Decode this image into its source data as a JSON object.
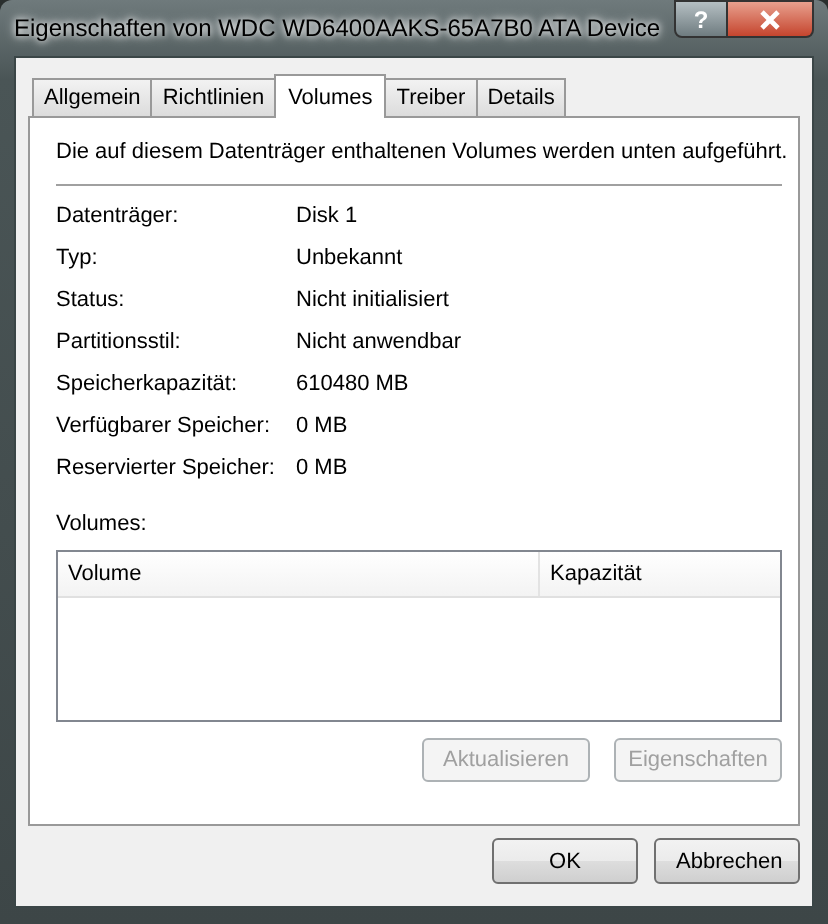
{
  "window": {
    "title": "Eigenschaften von WDC WD6400AAKS-65A7B0 ATA Device",
    "help": "?"
  },
  "tabs": [
    {
      "label": "Allgemein",
      "selected": false
    },
    {
      "label": "Richtlinien",
      "selected": false
    },
    {
      "label": "Volumes",
      "selected": true
    },
    {
      "label": "Treiber",
      "selected": false
    },
    {
      "label": "Details",
      "selected": false
    }
  ],
  "intro": "Die auf diesem Datenträger enthaltenen Volumes werden unten aufgeführt.",
  "properties": [
    {
      "label": "Datenträger:",
      "value": "Disk 1"
    },
    {
      "label": "Typ:",
      "value": "Unbekannt"
    },
    {
      "label": "Status:",
      "value": "Nicht initialisiert"
    },
    {
      "label": "Partitionsstil:",
      "value": "Nicht anwendbar"
    },
    {
      "label": "Speicherkapazität:",
      "value": "610480 MB"
    },
    {
      "label": "Verfügbarer Speicher:",
      "value": "0 MB"
    },
    {
      "label": "Reservierter Speicher:",
      "value": "0 MB"
    }
  ],
  "volumes": {
    "label": "Volumes:",
    "columns": [
      "Volume",
      "Kapazität"
    ]
  },
  "panel_buttons": [
    {
      "label": "Aktualisieren",
      "disabled": true
    },
    {
      "label": "Eigenschaften",
      "disabled": true
    }
  ],
  "dialog_buttons": [
    {
      "label": "OK",
      "disabled": false
    },
    {
      "label": "Abbrechen",
      "disabled": false
    }
  ]
}
